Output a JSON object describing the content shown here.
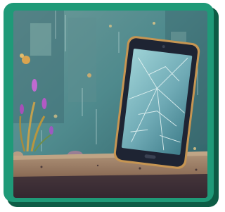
{
  "illustration": {
    "subject": "cracked-smartphone-on-ledge",
    "palette": {
      "frame": "#1f9a78",
      "frame_shadow": "#0d5c45",
      "rainy_window": "#4f8a8d",
      "phone_body": "#1e2433",
      "phone_rim": "#c69552",
      "phone_screen": "#7fb8c2",
      "ledge": "#8d6e58",
      "flowers": "#c06ad0"
    }
  }
}
